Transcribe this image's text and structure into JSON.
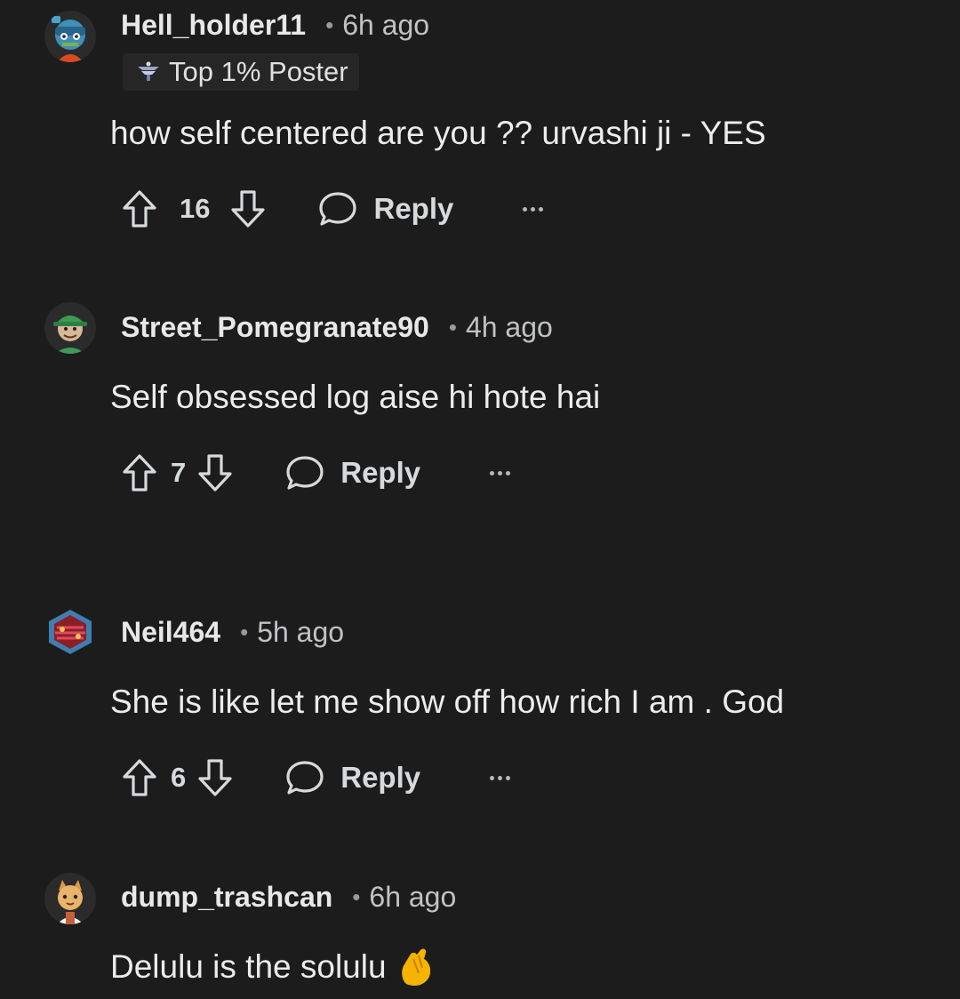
{
  "comments": [
    {
      "username": "Hell_holder11",
      "time": "6h ago",
      "flair": "Top 1% Poster",
      "body": "how self centered are you ?? urvashi ji - YES",
      "score": "16",
      "reply_label": "Reply",
      "avatar_icon": "avatar-zombie-icon"
    },
    {
      "username": "Street_Pomegranate90",
      "time": "4h ago",
      "body": "Self obsessed log aise hi hote hai",
      "score": "7",
      "reply_label": "Reply",
      "avatar_icon": "avatar-green-cap-icon"
    },
    {
      "username": "Neil464",
      "time": "5h ago",
      "body": "She is like let me show off how rich I am . God",
      "score": "6",
      "reply_label": "Reply",
      "avatar_icon": "avatar-hexagon-icon"
    },
    {
      "username": "dump_trashcan",
      "time": "6h ago",
      "body": "Delulu is the solulu",
      "body_emoji": "pinched-fingers-icon",
      "avatar_icon": "avatar-cat-icon"
    }
  ],
  "separator": "•",
  "colors": {
    "background": "#1c1c1c",
    "text": "#d7dadc",
    "muted": "#9a9a9a"
  }
}
